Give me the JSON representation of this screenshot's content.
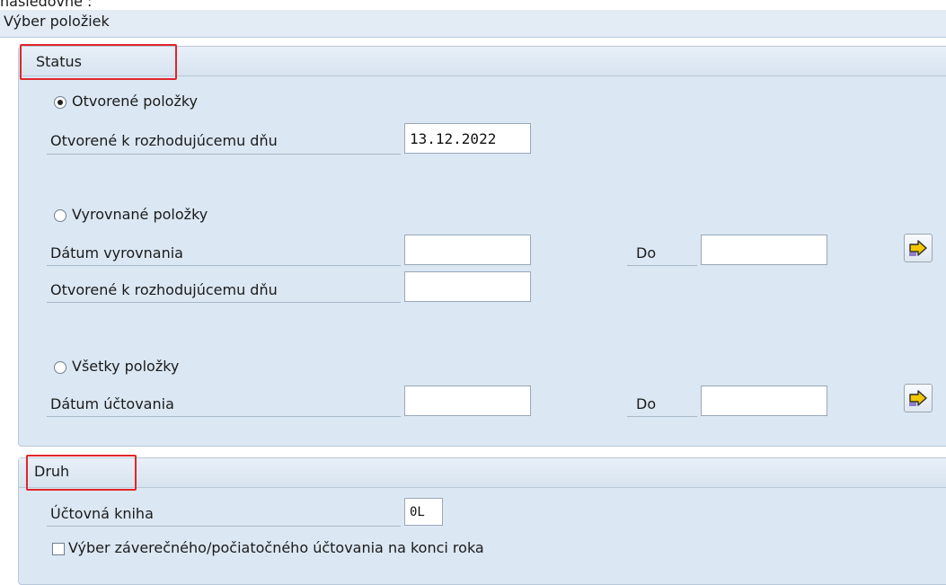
{
  "top_text": "nasledovne :",
  "page_title": "Výber položiek",
  "status_group": {
    "title": "Status",
    "open_items": {
      "radio_label": "Otvorené položky",
      "selected": true,
      "key_date_label": "Otvorené k rozhodujúcemu dňu",
      "key_date_value": "13.12.2022"
    },
    "cleared_items": {
      "radio_label": "Vyrovnané položky",
      "selected": false,
      "clearing_date_label": "Dátum vyrovnania",
      "clearing_date_from": "",
      "to_label": "Do",
      "clearing_date_to": "",
      "key_date_label": "Otvorené k rozhodujúcemu dňu",
      "key_date_value": "",
      "multiple_selection_icon": "arrow-right-icon"
    },
    "all_items": {
      "radio_label": "Všetky položky",
      "selected": false,
      "posting_date_label": "Dátum účtovania",
      "posting_date_from": "",
      "to_label": "Do",
      "posting_date_to": "",
      "multiple_selection_icon": "arrow-right-icon"
    }
  },
  "type_group": {
    "title": "Druh",
    "ledger_label": "Účtovná kniha",
    "ledger_value": "0L",
    "year_end_checkbox_label": "Výber záverečného/počiatočného účtovania na konci roka",
    "year_end_checked": false
  },
  "colors": {
    "group_bg": "#dbe7f2",
    "highlight": "#e0262b",
    "arrow_icon": "#f2c700"
  }
}
